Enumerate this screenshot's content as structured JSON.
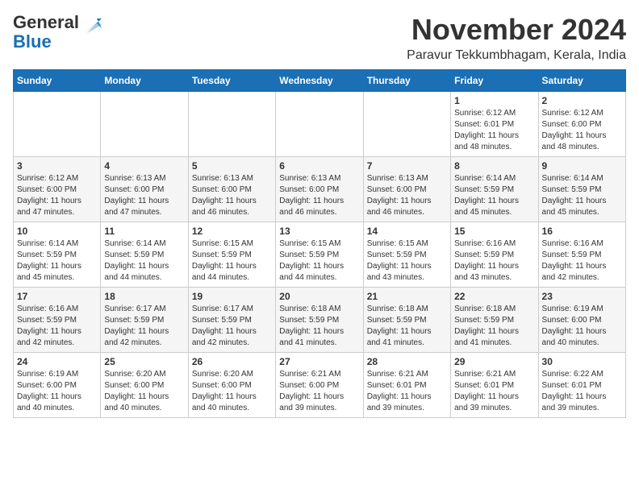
{
  "logo": {
    "line1": "General",
    "line2": "Blue"
  },
  "title": "November 2024",
  "location": "Paravur Tekkumbhagam, Kerala, India",
  "weekdays": [
    "Sunday",
    "Monday",
    "Tuesday",
    "Wednesday",
    "Thursday",
    "Friday",
    "Saturday"
  ],
  "weeks": [
    [
      {
        "day": "",
        "info": ""
      },
      {
        "day": "",
        "info": ""
      },
      {
        "day": "",
        "info": ""
      },
      {
        "day": "",
        "info": ""
      },
      {
        "day": "",
        "info": ""
      },
      {
        "day": "1",
        "info": "Sunrise: 6:12 AM\nSunset: 6:01 PM\nDaylight: 11 hours\nand 48 minutes."
      },
      {
        "day": "2",
        "info": "Sunrise: 6:12 AM\nSunset: 6:00 PM\nDaylight: 11 hours\nand 48 minutes."
      }
    ],
    [
      {
        "day": "3",
        "info": "Sunrise: 6:12 AM\nSunset: 6:00 PM\nDaylight: 11 hours\nand 47 minutes."
      },
      {
        "day": "4",
        "info": "Sunrise: 6:13 AM\nSunset: 6:00 PM\nDaylight: 11 hours\nand 47 minutes."
      },
      {
        "day": "5",
        "info": "Sunrise: 6:13 AM\nSunset: 6:00 PM\nDaylight: 11 hours\nand 46 minutes."
      },
      {
        "day": "6",
        "info": "Sunrise: 6:13 AM\nSunset: 6:00 PM\nDaylight: 11 hours\nand 46 minutes."
      },
      {
        "day": "7",
        "info": "Sunrise: 6:13 AM\nSunset: 6:00 PM\nDaylight: 11 hours\nand 46 minutes."
      },
      {
        "day": "8",
        "info": "Sunrise: 6:14 AM\nSunset: 5:59 PM\nDaylight: 11 hours\nand 45 minutes."
      },
      {
        "day": "9",
        "info": "Sunrise: 6:14 AM\nSunset: 5:59 PM\nDaylight: 11 hours\nand 45 minutes."
      }
    ],
    [
      {
        "day": "10",
        "info": "Sunrise: 6:14 AM\nSunset: 5:59 PM\nDaylight: 11 hours\nand 45 minutes."
      },
      {
        "day": "11",
        "info": "Sunrise: 6:14 AM\nSunset: 5:59 PM\nDaylight: 11 hours\nand 44 minutes."
      },
      {
        "day": "12",
        "info": "Sunrise: 6:15 AM\nSunset: 5:59 PM\nDaylight: 11 hours\nand 44 minutes."
      },
      {
        "day": "13",
        "info": "Sunrise: 6:15 AM\nSunset: 5:59 PM\nDaylight: 11 hours\nand 44 minutes."
      },
      {
        "day": "14",
        "info": "Sunrise: 6:15 AM\nSunset: 5:59 PM\nDaylight: 11 hours\nand 43 minutes."
      },
      {
        "day": "15",
        "info": "Sunrise: 6:16 AM\nSunset: 5:59 PM\nDaylight: 11 hours\nand 43 minutes."
      },
      {
        "day": "16",
        "info": "Sunrise: 6:16 AM\nSunset: 5:59 PM\nDaylight: 11 hours\nand 42 minutes."
      }
    ],
    [
      {
        "day": "17",
        "info": "Sunrise: 6:16 AM\nSunset: 5:59 PM\nDaylight: 11 hours\nand 42 minutes."
      },
      {
        "day": "18",
        "info": "Sunrise: 6:17 AM\nSunset: 5:59 PM\nDaylight: 11 hours\nand 42 minutes."
      },
      {
        "day": "19",
        "info": "Sunrise: 6:17 AM\nSunset: 5:59 PM\nDaylight: 11 hours\nand 42 minutes."
      },
      {
        "day": "20",
        "info": "Sunrise: 6:18 AM\nSunset: 5:59 PM\nDaylight: 11 hours\nand 41 minutes."
      },
      {
        "day": "21",
        "info": "Sunrise: 6:18 AM\nSunset: 5:59 PM\nDaylight: 11 hours\nand 41 minutes."
      },
      {
        "day": "22",
        "info": "Sunrise: 6:18 AM\nSunset: 5:59 PM\nDaylight: 11 hours\nand 41 minutes."
      },
      {
        "day": "23",
        "info": "Sunrise: 6:19 AM\nSunset: 6:00 PM\nDaylight: 11 hours\nand 40 minutes."
      }
    ],
    [
      {
        "day": "24",
        "info": "Sunrise: 6:19 AM\nSunset: 6:00 PM\nDaylight: 11 hours\nand 40 minutes."
      },
      {
        "day": "25",
        "info": "Sunrise: 6:20 AM\nSunset: 6:00 PM\nDaylight: 11 hours\nand 40 minutes."
      },
      {
        "day": "26",
        "info": "Sunrise: 6:20 AM\nSunset: 6:00 PM\nDaylight: 11 hours\nand 40 minutes."
      },
      {
        "day": "27",
        "info": "Sunrise: 6:21 AM\nSunset: 6:00 PM\nDaylight: 11 hours\nand 39 minutes."
      },
      {
        "day": "28",
        "info": "Sunrise: 6:21 AM\nSunset: 6:01 PM\nDaylight: 11 hours\nand 39 minutes."
      },
      {
        "day": "29",
        "info": "Sunrise: 6:21 AM\nSunset: 6:01 PM\nDaylight: 11 hours\nand 39 minutes."
      },
      {
        "day": "30",
        "info": "Sunrise: 6:22 AM\nSunset: 6:01 PM\nDaylight: 11 hours\nand 39 minutes."
      }
    ]
  ]
}
